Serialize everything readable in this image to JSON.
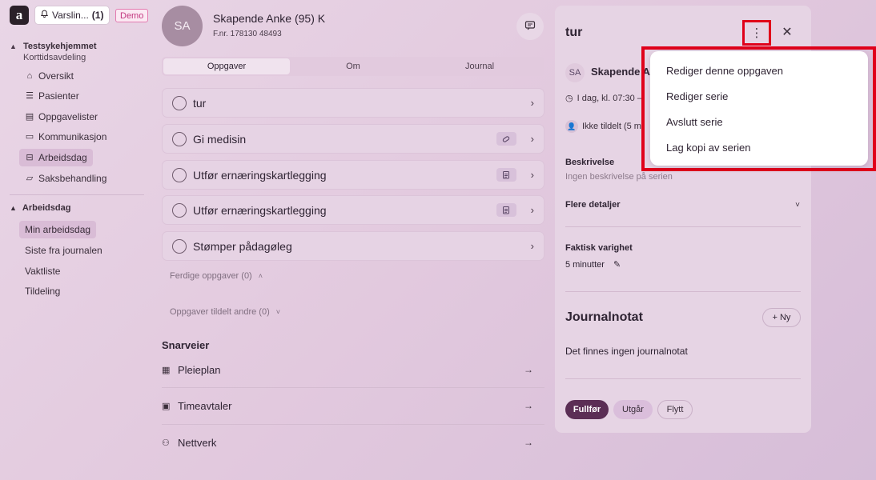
{
  "sidebar": {
    "logo": "a",
    "alert_button": {
      "label": "Varslin...",
      "count": "(1)"
    },
    "demo_badge": "Demo",
    "org": {
      "name": "Testsykehjemmet",
      "department": "Korttidsavdeling"
    },
    "nav": [
      {
        "label": "Oversikt",
        "icon": "home-icon"
      },
      {
        "label": "Pasienter",
        "icon": "list-icon"
      },
      {
        "label": "Oppgavelister",
        "icon": "clipboard-icon"
      },
      {
        "label": "Kommunikasjon",
        "icon": "message-icon"
      },
      {
        "label": "Arbeidsdag",
        "icon": "briefcase-icon"
      },
      {
        "label": "Saksbehandling",
        "icon": "folder-icon"
      }
    ],
    "section": {
      "title": "Arbeidsdag",
      "items": [
        "Min arbeidsdag",
        "Siste fra journalen",
        "Vaktliste",
        "Tildeling"
      ]
    }
  },
  "patient": {
    "initials": "SA",
    "name": "Skapende Anke (95) K",
    "id": "F.nr. 178130 48493"
  },
  "tabs": [
    "Oppgaver",
    "Om",
    "Journal"
  ],
  "tasks": [
    {
      "label": "tur",
      "badge": ""
    },
    {
      "label": "Gi medisin",
      "badge": "pill-icon"
    },
    {
      "label": "Utfør ernæringskartlegging",
      "badge": "clipboard-icon"
    },
    {
      "label": "Utfør ernæringskartlegging",
      "badge": "clipboard-icon"
    },
    {
      "label": "Stømper pådagøleg",
      "badge": ""
    }
  ],
  "completed_tasks": "Ferdige oppgaver (0)",
  "others_tasks": "Oppgaver tildelt andre (0)",
  "shortcuts": {
    "title": "Snarveier",
    "items": [
      "Pleieplan",
      "Timeavtaler",
      "Nettverk"
    ]
  },
  "detail": {
    "title": "tur",
    "patient_initials": "SA",
    "patient_name": "Skapende Anke",
    "time": "I dag, kl. 07:30 –",
    "assignee": "Ikke tildelt (5 m",
    "description_label": "Beskrivelse",
    "description_empty": "Ingen beskrivelse på serien",
    "more_details": "Flere detaljer",
    "duration_label": "Faktisk varighet",
    "duration_value": "5 minutter",
    "journal_title": "Journalnotat",
    "journal_new": "Ny",
    "journal_empty": "Det finnes ingen journalnotat",
    "actions": {
      "complete": "Fullfør",
      "expire": "Utgår",
      "move": "Flytt"
    }
  },
  "menu": {
    "items": [
      "Rediger denne oppgaven",
      "Rediger serie",
      "Avslutt serie",
      "Lag kopi av serien"
    ]
  },
  "colors": {
    "accent": "#5b2e55",
    "highlight": "#e0001a",
    "demo": "#c2377f"
  }
}
